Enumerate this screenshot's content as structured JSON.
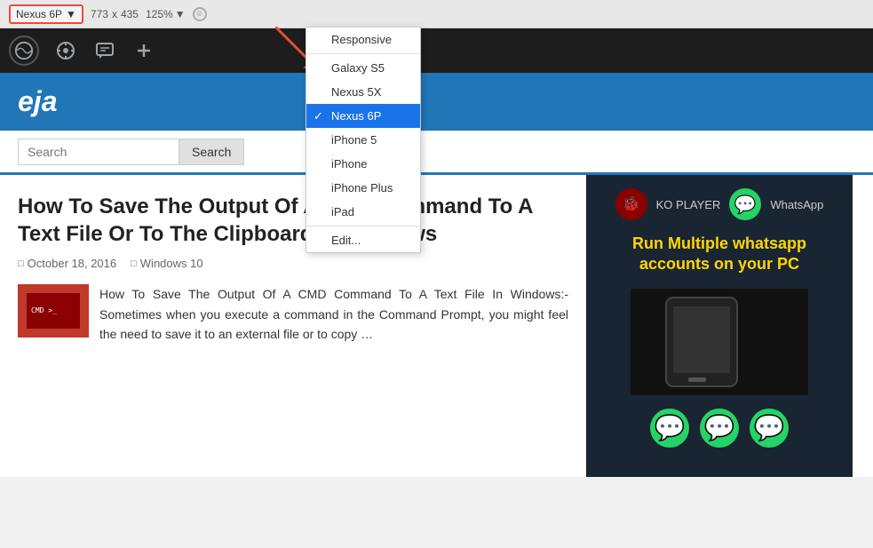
{
  "toolbar": {
    "device_label": "Nexus 6P",
    "arrow": "▼",
    "width": "773",
    "x_separator": "x",
    "height": "435",
    "zoom": "125%",
    "zoom_arrow": "▼"
  },
  "dropdown": {
    "items": [
      {
        "id": "responsive",
        "label": "Responsive",
        "selected": false
      },
      {
        "id": "galaxy-s5",
        "label": "Galaxy S5",
        "selected": false
      },
      {
        "id": "nexus-5x",
        "label": "Nexus 5X",
        "selected": false
      },
      {
        "id": "nexus-6p",
        "label": "Nexus 6P",
        "selected": true
      },
      {
        "id": "iphone-5",
        "label": "iPhone 5",
        "selected": false
      },
      {
        "id": "iphone-6",
        "label": "iPhone",
        "selected": false
      },
      {
        "id": "iphone-6-plus",
        "label": "iPhone Plus",
        "selected": false
      },
      {
        "id": "ipad",
        "label": "iPad",
        "selected": false
      },
      {
        "id": "edit",
        "label": "Edit...",
        "selected": false
      }
    ]
  },
  "admin_bar": {
    "wp_logo": "W"
  },
  "site_header": {
    "title": "eja"
  },
  "search": {
    "placeholder": "Search",
    "button_label": "Search"
  },
  "article": {
    "title": "How To Save The Output Of A CMD Command To A Text File Or To The Clipboard In Windows",
    "date": "October 18, 2016",
    "category": "Windows 10",
    "excerpt": "How To Save The Output Of A CMD Command To A Text File In Windows:- Sometimes when you execute a command in the Command Prompt, you might feel the need to save it to an external file or to copy …"
  },
  "ad": {
    "brand1": "KO PLAYER",
    "brand2": "WhatsApp",
    "headline": "Run Multiple whatsapp accounts on your PC",
    "whatsapp_symbol": "📱"
  }
}
